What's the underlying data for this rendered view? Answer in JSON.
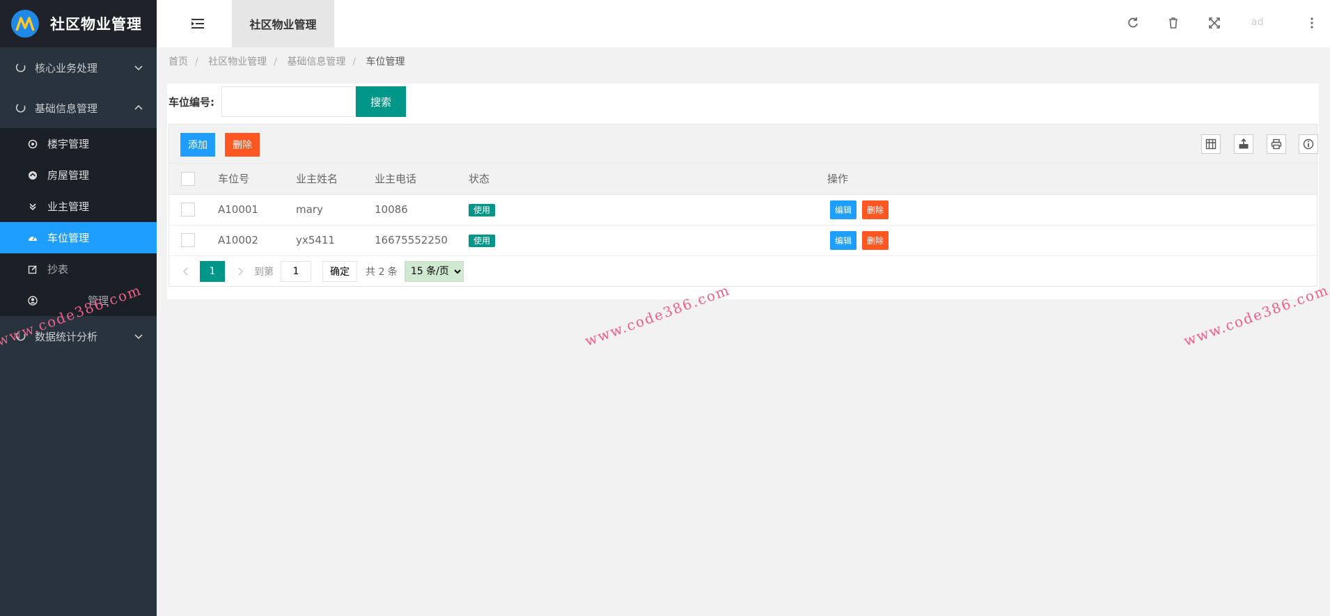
{
  "app": {
    "title": "社区物业管理",
    "accent": "#009688",
    "blue": "#1e9fff",
    "orange": "#ff5722"
  },
  "sidebar": {
    "groups": [
      {
        "label": "核心业务处理",
        "icon": "circle-icon",
        "expanded": false
      },
      {
        "label": "基础信息管理",
        "icon": "circle-icon",
        "expanded": true
      },
      {
        "label": "数据统计分析",
        "icon": "circle-icon",
        "expanded": false
      }
    ],
    "sub_items": [
      {
        "label": "楼宇管理",
        "icon": "target-icon"
      },
      {
        "label": "房屋管理",
        "icon": "home-icon"
      },
      {
        "label": "业主管理",
        "icon": "chevron-down-icon"
      },
      {
        "label": "车位管理",
        "icon": "dashboard-icon",
        "active": true
      },
      {
        "label": "抄表",
        "icon": "edit-icon"
      },
      {
        "label": "管理",
        "icon": "user-icon"
      }
    ]
  },
  "header": {
    "tab": "社区物业管理",
    "user": "ad",
    "icons": [
      "refresh-icon",
      "trash-icon",
      "fullscreen-icon",
      "more-icon"
    ]
  },
  "breadcrumb": {
    "items": [
      "首页",
      "社区物业管理",
      "基础信息管理",
      "车位管理"
    ]
  },
  "search": {
    "label": "车位编号:",
    "input_value": "",
    "button": "搜索"
  },
  "toolbar": {
    "add": "添加",
    "delete": "删除",
    "icons": [
      "columns-icon",
      "export-icon",
      "print-icon",
      "info-icon"
    ]
  },
  "table": {
    "columns": [
      "车位号",
      "业主姓名",
      "业主电话",
      "状态",
      "操作"
    ],
    "rows": [
      {
        "code": "A10001",
        "owner": "mary",
        "phone": "10086",
        "status": "使用",
        "edit": "编辑",
        "del": "删除"
      },
      {
        "code": "A10002",
        "owner": "yx5411",
        "phone": "16675552250",
        "status": "使用",
        "edit": "编辑",
        "del": "删除"
      }
    ]
  },
  "pager": {
    "current": "1",
    "goto_label": "到第",
    "goto_value": "1",
    "confirm": "确定",
    "total": "共 2 条",
    "page_size": "15 条/页"
  },
  "watermark": "www.code386.com"
}
